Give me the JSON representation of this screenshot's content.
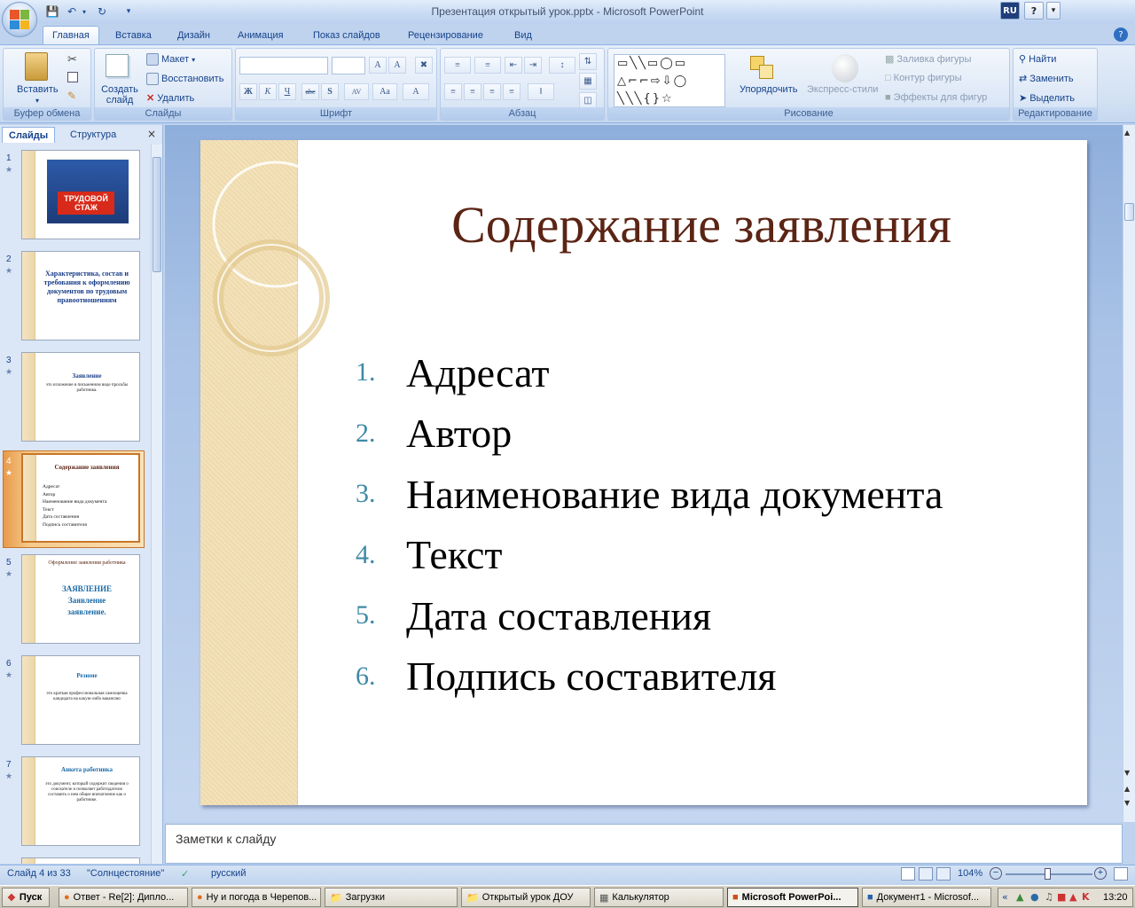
{
  "window": {
    "title": "Презентация открытый урок.pptx - Microsoft PowerPoint",
    "lang_indicator": "RU",
    "help": "?"
  },
  "ribbon_tabs": [
    "Главная",
    "Вставка",
    "Дизайн",
    "Анимация",
    "Показ слайдов",
    "Рецензирование",
    "Вид"
  ],
  "ribbon": {
    "clipboard": {
      "paste": "Вставить",
      "label": "Буфер обмена"
    },
    "slides": {
      "new_slide": "Создать слайд",
      "layout": "Макет",
      "reset": "Восстановить",
      "delete": "Удалить",
      "label": "Слайды"
    },
    "font": {
      "label": "Шрифт"
    },
    "paragraph": {
      "label": "Абзац"
    },
    "drawing": {
      "arrange": "Упорядочить",
      "quick_styles": "Экспресс-стили",
      "fill": "Заливка фигуры",
      "outline": "Контур фигуры",
      "effects": "Эффекты для фигур",
      "label": "Рисование"
    },
    "editing": {
      "find": "Найти",
      "replace": "Заменить",
      "select": "Выделить",
      "label": "Редактирование"
    }
  },
  "pane": {
    "tab_slides": "Слайды",
    "tab_outline": "Структура",
    "close": "×"
  },
  "thumbnails": [
    {
      "num": "1",
      "title": "ТРУДОВОЙ СТАЖ"
    },
    {
      "num": "2",
      "title": "Характеристика, состав и требования к оформлению документов по трудовым правоотношениям"
    },
    {
      "num": "3",
      "title": "Заявление",
      "body": "это изложение в письменном виде просьбы работника."
    },
    {
      "num": "4",
      "title": "Содержание заявления",
      "items": [
        "Адресат",
        "Автор",
        "Наименование вида документа",
        "Текст",
        "Дата составления",
        "Подпись составителя"
      ]
    },
    {
      "num": "5",
      "title": "Оформление заявления работника",
      "body": "ЗАЯВЛЕНИЕ Заявление заявление."
    },
    {
      "num": "6",
      "title": "Резюме",
      "body": "это краткая профессиональная самооценка кандидата на какую-либо вакансию"
    },
    {
      "num": "7",
      "title": "Анкета работника",
      "body": "это документ, который содержит сведения о соискателе и позволяет работодателю составить о нем общее впечатление как о работнике."
    }
  ],
  "slide": {
    "title": "Содержание заявления",
    "items": [
      {
        "n": "1.",
        "text": "Адресат"
      },
      {
        "n": "2.",
        "text": "Автор"
      },
      {
        "n": "3.",
        "text": "Наименование вида документа"
      },
      {
        "n": "4.",
        "text": "Текст"
      },
      {
        "n": "5.",
        "text": "Дата составления"
      },
      {
        "n": "6.",
        "text": "Подпись составителя"
      }
    ]
  },
  "notes_placeholder": "Заметки к слайду",
  "status": {
    "slide_info": "Слайд 4 из 33",
    "theme": "\"Солнцестояние\"",
    "language": "русский",
    "zoom": "104%"
  },
  "taskbar": {
    "start": "Пуск",
    "items": [
      "Ответ - Re[2]: Дипло...",
      "Ну и погода в Черепов...",
      "Загрузки",
      "Открытый урок ДОУ",
      "Калькулятор",
      "Microsoft PowerPoi...",
      "Документ1 - Microsof..."
    ],
    "clock": "13:20"
  },
  "colors": {
    "title_color": "#5b2414",
    "number_color": "#3f8aa6",
    "accent_orange": "#e89a4a"
  }
}
